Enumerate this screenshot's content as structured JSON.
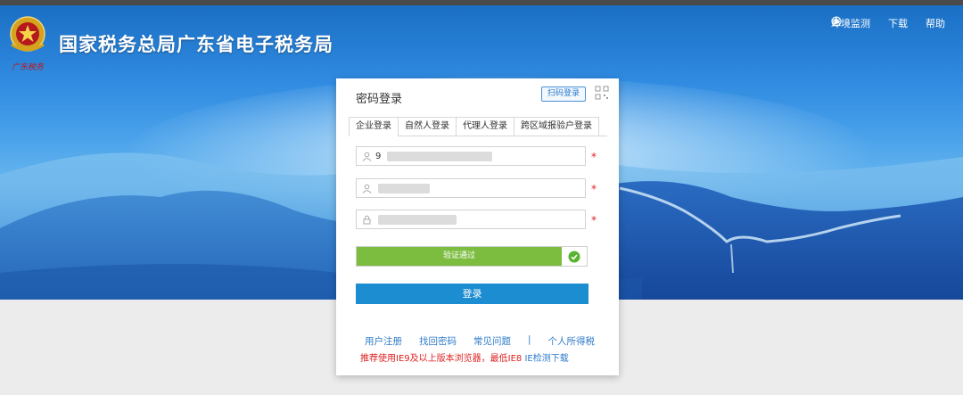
{
  "header": {
    "title": "国家税务总局广东省电子税务局",
    "emblem_caption": "广东税务",
    "links": [
      {
        "icon": "wrench-icon",
        "label": "环境监测"
      },
      {
        "icon": "download-icon",
        "label": "下载"
      },
      {
        "icon": "help-circle-icon",
        "label": "帮助"
      }
    ]
  },
  "login": {
    "title": "密码登录",
    "qr_label": "扫码登录",
    "tabs": [
      "企业登录",
      "自然人登录",
      "代理人登录",
      "跨区域报验户登录"
    ],
    "active_tab": 0,
    "fields": [
      {
        "icon": "user-icon",
        "value": "9"
      },
      {
        "icon": "user-icon",
        "value": ""
      },
      {
        "icon": "lock-icon",
        "value": ""
      }
    ],
    "required_mark": "*",
    "verify_label": "验证通过",
    "submit_label": "登录",
    "links": [
      "用户注册",
      "找回密码",
      "常见问题",
      "|",
      "个人所得税"
    ],
    "notice": "推荐使用IE9及以上版本浏览器，最低IE8",
    "notice_link": "IE检测下载"
  },
  "colors": {
    "primary_blue": "#1d8dd1",
    "verify_green": "#7cbd40",
    "link_blue": "#2f7cc9",
    "warn_red": "#e02020"
  }
}
